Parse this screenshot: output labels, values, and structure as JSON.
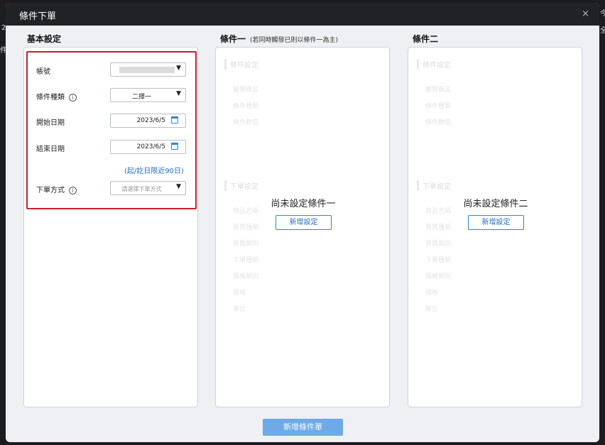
{
  "dialog": {
    "title": "條件下單",
    "close": "×"
  },
  "background": {
    "s1": "2",
    "s2": "件",
    "s3": "今",
    "s4": "全"
  },
  "basic": {
    "header": "基本設定",
    "account": {
      "label": "帳號",
      "value": ""
    },
    "condition_type": {
      "label": "條件種類",
      "value": "二擇一"
    },
    "start_date": {
      "label": "開始日期",
      "value": "2023/6/5"
    },
    "end_date": {
      "label": "結束日期",
      "value": "2023/6/5"
    },
    "date_note": "(起/訖日限近90日)",
    "order_method": {
      "label": "下單方式",
      "placeholder": "請選擇下單方式"
    },
    "info_glyph": "i",
    "dropdown_glyph": "▼"
  },
  "cond1": {
    "header": "條件一",
    "sub": "(若同時觸發已則以條件一為主)",
    "empty_message": "尚未設定條件一",
    "button": "新增設定"
  },
  "cond2": {
    "header": "條件二",
    "empty_message": "尚未設定條件二",
    "button": "新增設定"
  },
  "ghost": {
    "cond_setting": "條件設定",
    "cond_items": [
      "觸發商品",
      "條件種類",
      "條件數值"
    ],
    "order_setting": "下單設定",
    "order_items": [
      "商品名稱",
      "買賣種類",
      "買賣類別",
      "下單種類",
      "價格類別",
      "價格",
      "單位"
    ]
  },
  "footer": {
    "submit": "新增條件單"
  },
  "colors": {
    "accent": "#2c86d4",
    "highlight": "#c8202a",
    "titlebar": "#212226"
  }
}
